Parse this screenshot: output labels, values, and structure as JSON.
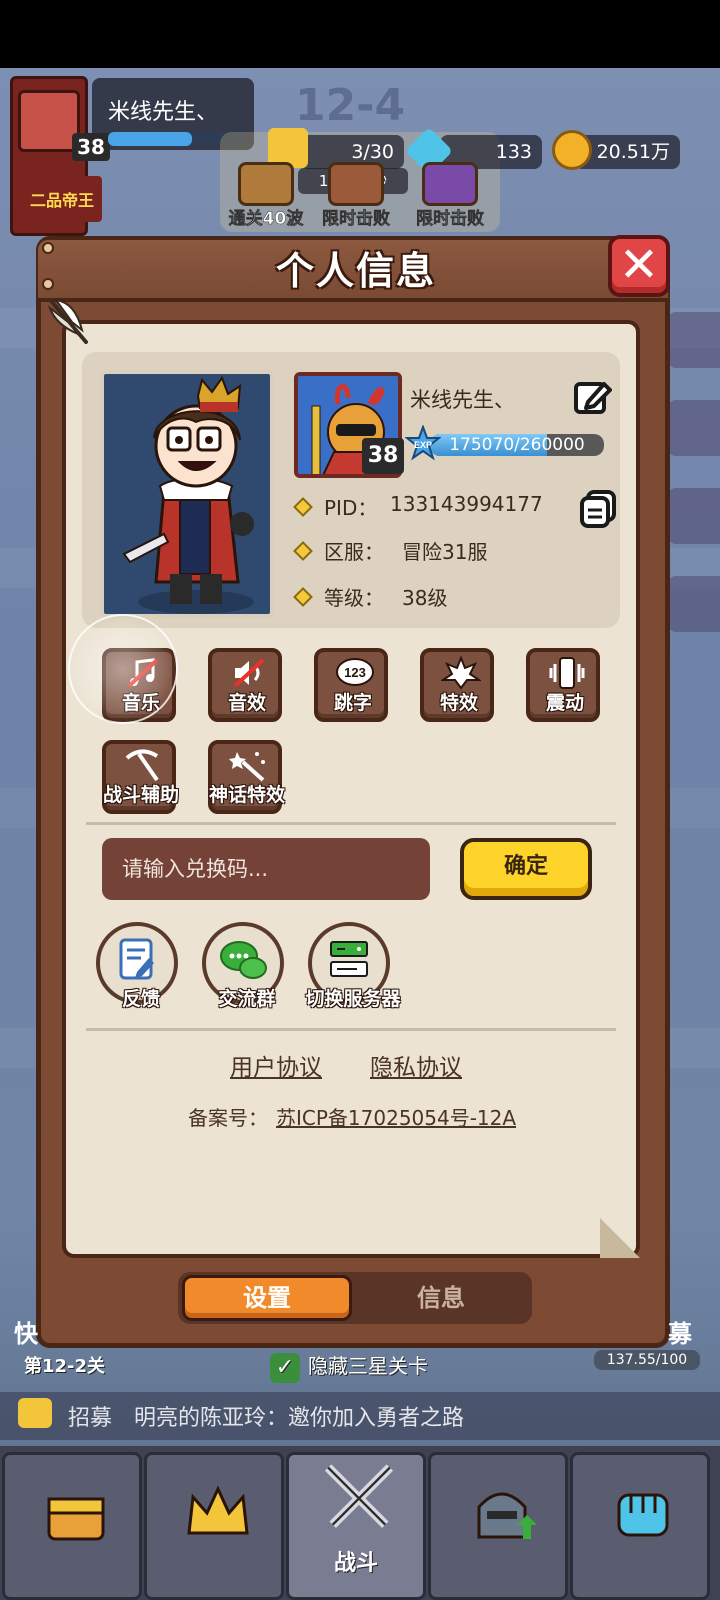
{
  "hud": {
    "player_name": "米线先生、",
    "player_level": "38",
    "rank": "二品帝王",
    "stage": "12-4",
    "progress": "3/30",
    "timer": "14分37秒",
    "gems": "133",
    "gold": "20.51万",
    "tasks": [
      {
        "label": "通关40波"
      },
      {
        "label": "限时击败"
      },
      {
        "label": "限时击败"
      }
    ]
  },
  "panel": {
    "title": "个人信息",
    "close_icon": "close-icon"
  },
  "profile": {
    "name": "米线先生、",
    "level_badge": "38",
    "exp_label": "EXP",
    "exp_text": "175070/260000",
    "exp_current": 175070,
    "exp_max": 260000,
    "rows": [
      {
        "label": "PID：",
        "value": "133143994177"
      },
      {
        "label": "区服：",
        "value": "冒险31服"
      },
      {
        "label": "等级：",
        "value": "38级"
      }
    ]
  },
  "settings": {
    "buttons": [
      {
        "label": "音乐",
        "icon": "music-off-icon",
        "enabled": false
      },
      {
        "label": "音效",
        "icon": "sound-off-icon",
        "enabled": false
      },
      {
        "label": "跳字",
        "icon": "damage-numbers-icon",
        "enabled": true
      },
      {
        "label": "特效",
        "icon": "explosion-icon",
        "enabled": true
      },
      {
        "label": "震动",
        "icon": "vibration-icon",
        "enabled": true
      },
      {
        "label": "战斗辅助",
        "icon": "pickaxe-icon",
        "enabled": true
      },
      {
        "label": "神话特效",
        "icon": "magic-wand-icon",
        "enabled": true
      }
    ]
  },
  "redeem": {
    "placeholder": "请输入兑换码...",
    "confirm_label": "确定"
  },
  "actions": [
    {
      "label": "反馈",
      "icon": "feedback-icon"
    },
    {
      "label": "交流群",
      "icon": "chat-icon"
    },
    {
      "label": "切换服务器",
      "icon": "server-icon"
    }
  ],
  "legal": {
    "user_agreement": "用户协议",
    "privacy": "隐私协议",
    "icp_label": "备案号：",
    "icp_value": "苏ICP备17025054号-12A"
  },
  "tabs": {
    "active": "设置",
    "inactive": "信息"
  },
  "bottom": {
    "stage_label": "第12-2关",
    "hide_3star": "隐藏三星关卡",
    "recruit_tag": "招募",
    "recruit_msg": "明亮的陈亚玲：邀你加入勇者之路",
    "left_label": "快",
    "right_label": "募",
    "right_progress": "137.55/100",
    "nav": [
      {
        "label": "",
        "icon": "shop-chest-icon"
      },
      {
        "label": "",
        "icon": "crown-icon"
      },
      {
        "label": "战斗",
        "icon": "crossed-swords-icon"
      },
      {
        "label": "",
        "icon": "knight-helmet-icon"
      },
      {
        "label": "",
        "icon": "fist-icon"
      }
    ]
  },
  "colors": {
    "panel_wood": "#7d4a33",
    "paper": "#ece3d3",
    "confirm_yellow": "#ffd42a",
    "active_tab_orange": "#f08a2a",
    "close_red": "#e14646"
  }
}
